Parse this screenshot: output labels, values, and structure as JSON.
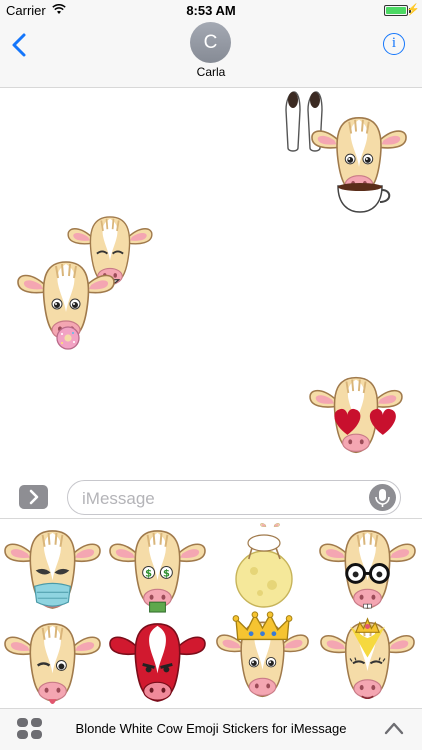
{
  "status_bar": {
    "carrier": "Carrier",
    "time": "8:53 AM"
  },
  "header": {
    "avatar_initial": "C",
    "contact_name": "Carla"
  },
  "chat": {
    "stickers": [
      {
        "name": "cow-with-coffee-sticker"
      },
      {
        "name": "cow-smiling-sticker"
      },
      {
        "name": "cow-with-donut-sticker"
      },
      {
        "name": "cow-heart-eyes-sticker"
      }
    ]
  },
  "input": {
    "placeholder": "iMessage"
  },
  "drawer": {
    "stickers": [
      {
        "name": "cow-face-mask-sticker"
      },
      {
        "name": "cow-money-eyes-sticker"
      },
      {
        "name": "cow-over-moon-sticker"
      },
      {
        "name": "cow-glasses-sticker"
      },
      {
        "name": "cow-wink-tongue-sticker"
      },
      {
        "name": "red-cow-sticker"
      },
      {
        "name": "cow-king-crown-sticker"
      },
      {
        "name": "cow-princess-tiara-sticker"
      }
    ]
  },
  "bottom_bar": {
    "title": "Blonde White Cow Emoji Stickers for iMessage"
  },
  "colors": {
    "accent": "#1476fb",
    "cow_skin": "#f5dca8",
    "cow_outline": "#a07a4c",
    "snout": "#f4a6b2"
  }
}
